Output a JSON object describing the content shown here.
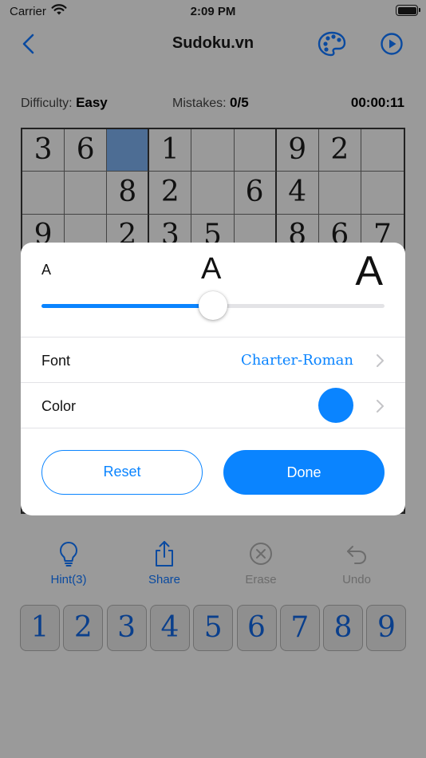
{
  "status_bar": {
    "carrier": "Carrier",
    "time": "2:09 PM"
  },
  "nav": {
    "title": "Sudoku.vn"
  },
  "info": {
    "difficulty_label": "Difficulty:",
    "difficulty_value": "Easy",
    "mistakes_label": "Mistakes:",
    "mistakes_value": "0/5",
    "timer": "00:00:11"
  },
  "board": {
    "rows": [
      [
        "3",
        "6",
        "",
        "1",
        "",
        "",
        "9",
        "2",
        ""
      ],
      [
        "",
        "",
        "8",
        "2",
        "",
        "6",
        "4",
        "",
        ""
      ],
      [
        "9",
        "",
        "2",
        "3",
        "5",
        "",
        "8",
        "6",
        "7"
      ],
      [
        "",
        "",
        "",
        "",
        "",
        "",
        "",
        "",
        ""
      ],
      [
        "",
        "",
        "",
        "",
        "",
        "",
        "",
        "",
        ""
      ],
      [
        "",
        "",
        "",
        "",
        "",
        "",
        "",
        "",
        ""
      ],
      [
        "",
        "",
        "",
        "",
        "",
        "",
        "",
        "",
        ""
      ],
      [
        "",
        "",
        "",
        "",
        "",
        "",
        "",
        "",
        ""
      ],
      [
        "",
        "",
        "",
        "",
        "",
        "",
        "",
        "",
        ""
      ]
    ],
    "selected_cell": {
      "row": 0,
      "col": 2
    }
  },
  "toolbar": {
    "hint_label": "Hint(3)",
    "share_label": "Share",
    "erase_label": "Erase",
    "undo_label": "Undo"
  },
  "number_pad": [
    "1",
    "2",
    "3",
    "4",
    "5",
    "6",
    "7",
    "8",
    "9"
  ],
  "settings_popup": {
    "size_small_label": "A",
    "size_mid_label": "A",
    "size_large_label": "A",
    "size_slider_value": 0.5,
    "font_label": "Font",
    "font_value": "Charter-Roman",
    "color_label": "Color",
    "color_value": "#0a84ff",
    "reset_label": "Reset",
    "done_label": "Done"
  },
  "colors": {
    "accent": "#0a84ff",
    "selected_cell": "#4d6d94",
    "dim_background": "#9a9a9a",
    "pad_digit": "#0a3f8c"
  }
}
